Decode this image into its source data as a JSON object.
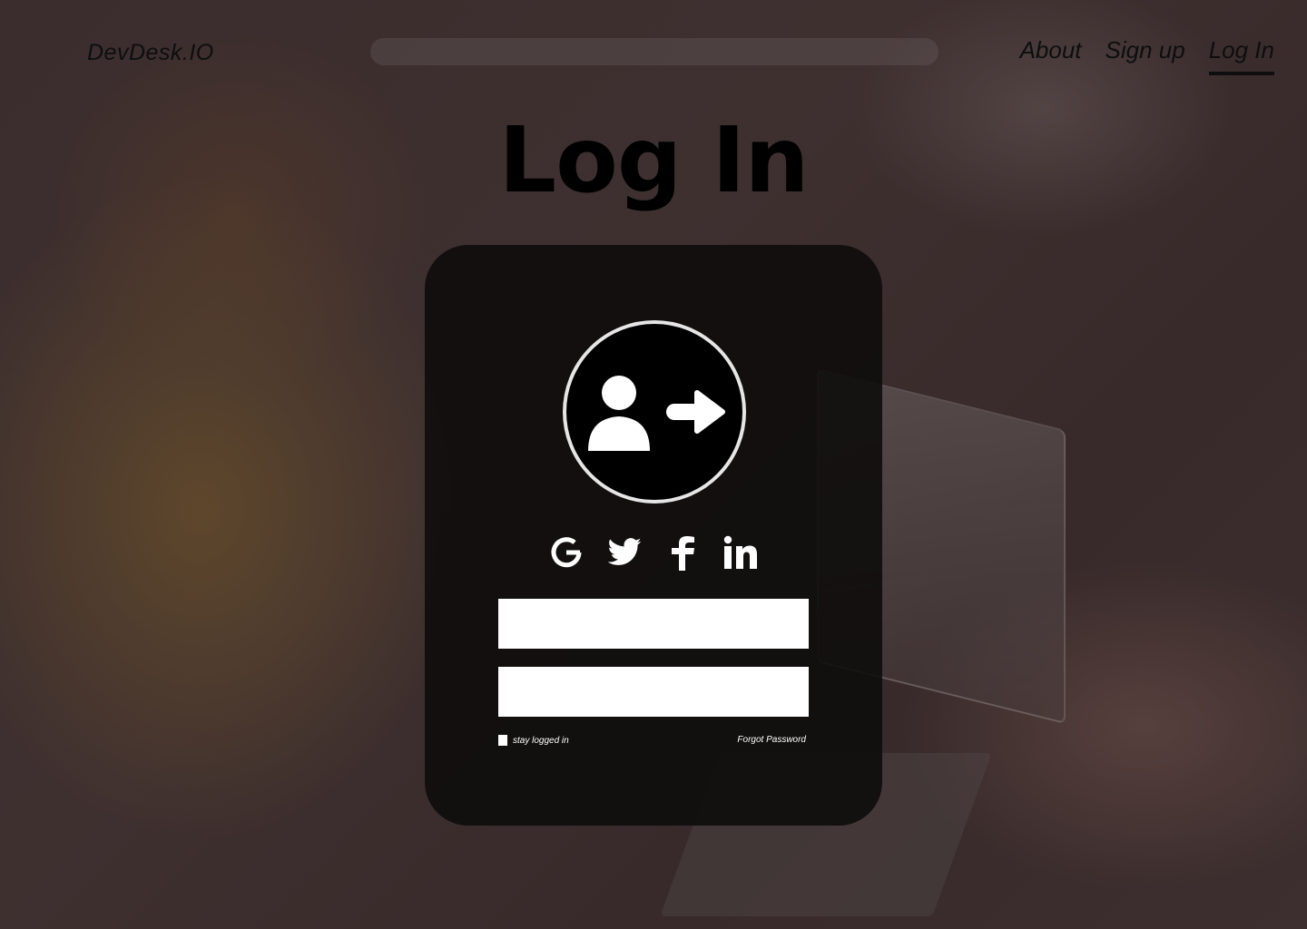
{
  "brand": "DevDesk.IO",
  "nav": [
    {
      "label": "About"
    },
    {
      "label": "Sign up"
    },
    {
      "label": "Log In",
      "active": true
    }
  ],
  "title": "Log In",
  "login_icon": "user-login-icon",
  "social": [
    {
      "icon": "google-icon"
    },
    {
      "icon": "twitter-icon"
    },
    {
      "icon": "facebook-icon"
    },
    {
      "icon": "linkedin-icon"
    }
  ],
  "form": {
    "username_value": "",
    "password_value": "",
    "remember_label": "stay logged in",
    "forgot_label": "Forgot Password"
  },
  "colors": {
    "card": "#0e0c0c",
    "title": "#000000",
    "field": "#ffffff"
  }
}
